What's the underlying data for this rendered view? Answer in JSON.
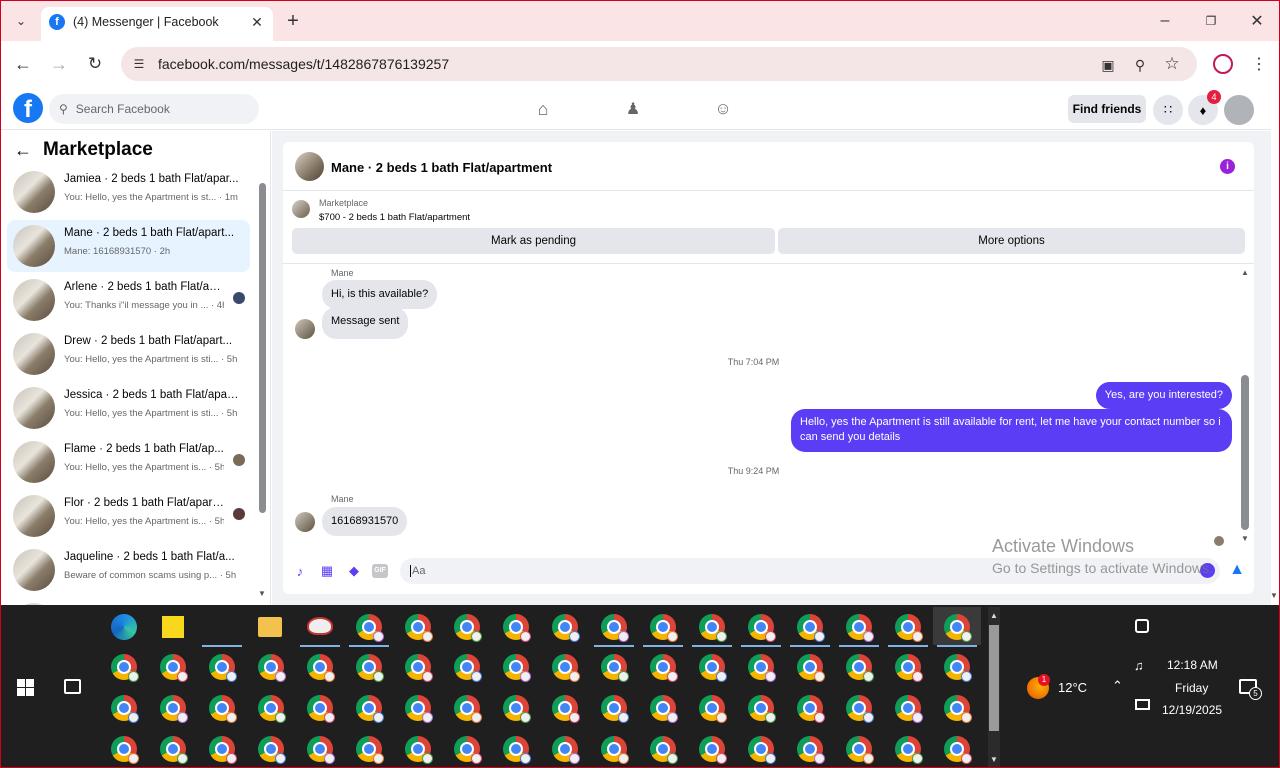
{
  "browser": {
    "tab_title": "(4) Messenger | Facebook",
    "url": "facebook.com/messages/t/1482867876139257"
  },
  "fb": {
    "search_placeholder": "Search Facebook",
    "find_friends": "Find friends",
    "notif_count": "4"
  },
  "sidebar": {
    "title": "Marketplace",
    "conversations": [
      {
        "name": "Jamiea · 2 beds 1 bath Flat/apar...",
        "preview": "You: Hello, yes the Apartment is st... · 1m",
        "selected": false
      },
      {
        "name": "Mane · 2 beds 1 bath Flat/apart...",
        "preview": "Mane: 16168931570 · 2h",
        "selected": true
      },
      {
        "name": "Arlene · 2 beds 1 bath Flat/ap...",
        "preview": "You: Thanks i\"il message you in ... · 4h",
        "selected": false
      },
      {
        "name": "Drew · 2 beds 1 bath Flat/apart...",
        "preview": "You: Hello, yes the Apartment is sti... · 5h",
        "selected": false
      },
      {
        "name": "Jessica · 2 beds 1 bath Flat/apart...",
        "preview": "You: Hello, yes the Apartment is sti... · 5h",
        "selected": false
      },
      {
        "name": "Flame · 2 beds 1 bath Flat/ap...",
        "preview": "You: Hello, yes the Apartment is... · 5h",
        "selected": false
      },
      {
        "name": "Flor · 2 beds 1 bath Flat/apart...",
        "preview": "You: Hello, yes the Apartment is... · 5h",
        "selected": false
      },
      {
        "name": "Jaqueline · 2 beds 1 bath Flat/a...",
        "preview": "Beware of common scams using p... · 5h",
        "selected": false
      }
    ]
  },
  "chat": {
    "header_title": "Mane · 2 beds 1 bath Flat/apartment",
    "listing_label": "Marketplace",
    "listing_title": "$700 - 2 beds 1 bath Flat/apartment",
    "mark_pending": "Mark as pending",
    "more_options": "More options",
    "sender_name_1": "Mane",
    "msg_in_1": "Hi, is this available?",
    "msg_in_2": "Message sent",
    "time_1": "Thu 7:04 PM",
    "msg_out_1": "Yes, are you interested?",
    "msg_out_2": "Hello, yes the Apartment is still available for rent, let me have your contact number so i can send you details",
    "time_2": "Thu 9:24 PM",
    "sender_name_2": "Mane",
    "msg_in_3": "16168931570",
    "composer_placeholder": "Aa"
  },
  "watermark": {
    "line1": "Activate Windows",
    "line2": "Go to Settings to activate Windows."
  },
  "taskbar": {
    "temp": "12°C",
    "weather_badge": "1",
    "time": "12:18 AM",
    "day": "Friday",
    "date": "12/19/2025",
    "notif_count": "5"
  },
  "colors": {
    "fb_blue": "#1877f2",
    "outgoing_bubble": "#5b3df5",
    "selected_row": "#e7f3ff",
    "taskbar": "#1f1f1f"
  }
}
